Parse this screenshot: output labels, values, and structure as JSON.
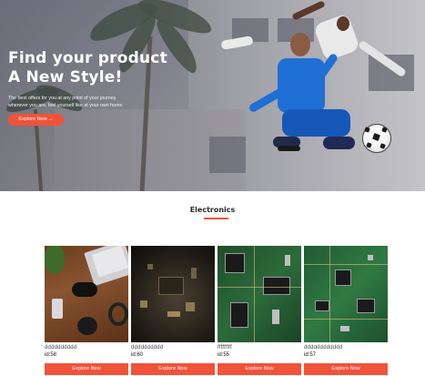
{
  "hero": {
    "title_line1": "Find your product",
    "title_line2": "A New Style!",
    "subtitle_line1": "The best offers for you at any point of your journey.",
    "subtitle_line2": "wherever you are, feel yourself like at your own home",
    "button_label": "Explore Now →"
  },
  "section": {
    "title": "Electronics"
  },
  "products": [
    {
      "name": "dddddddddd",
      "id": "id:58",
      "button": "Explore Now",
      "image": "laptop-gamepad-desk-photo"
    },
    {
      "name": "dddddddddd",
      "id": "id:60",
      "button": "Explore Now",
      "image": "circuit-board-closeup-photo"
    },
    {
      "name": "fffffffff",
      "id": "id:55",
      "button": "Explore Now",
      "image": "green-pcb-photo"
    },
    {
      "name": "dddddddddddd",
      "id": "id:57",
      "button": "Explore Now",
      "image": "green-pcb-photo-2"
    }
  ],
  "colors": {
    "accent": "#f0533a",
    "title_text": "#2a2a2a"
  }
}
